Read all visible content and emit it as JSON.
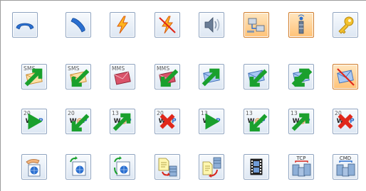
{
  "toolbar": {
    "rows": [
      [
        {
          "name": "hangup-button",
          "icon": "hangup-icon"
        },
        {
          "name": "call-button",
          "icon": "call-icon"
        },
        {
          "name": "lightning-button",
          "icon": "lightning-icon"
        },
        {
          "name": "lightning-off-button",
          "icon": "lightning-off-icon"
        },
        {
          "name": "speaker-button",
          "icon": "speaker-icon"
        },
        {
          "name": "network-button",
          "icon": "network-icon",
          "active": true
        },
        {
          "name": "signal-tower-button",
          "icon": "signal-tower-icon",
          "active": true
        },
        {
          "name": "key-button",
          "icon": "key-icon"
        }
      ],
      [
        {
          "name": "sms-send-button",
          "icon": "sms-envelope-icon",
          "label": "SMS",
          "badge": "send"
        },
        {
          "name": "sms-receive-button",
          "icon": "sms-envelope-icon",
          "label": "SMS",
          "badge": "receive"
        },
        {
          "name": "mms-button",
          "icon": "mms-envelope-icon",
          "label": "MMS"
        },
        {
          "name": "mms-receive-button",
          "icon": "mms-envelope-icon",
          "label": "MMS",
          "badge": "receive"
        },
        {
          "name": "email-send-button",
          "icon": "email-icon",
          "badge": "send"
        },
        {
          "name": "email-receive-button",
          "icon": "email-icon",
          "badge": "receive"
        },
        {
          "name": "email-send-receive-button",
          "icon": "email-icon",
          "badge": "both"
        },
        {
          "name": "email-cancel-button",
          "icon": "email-cancel-icon",
          "active": true
        }
      ],
      [
        {
          "name": "wap-20-play-button",
          "icon": "wap-icon",
          "label": "20",
          "badge": "play"
        },
        {
          "name": "wap-20-receive-button",
          "icon": "wap-icon",
          "label": "20",
          "badge": "receive"
        },
        {
          "name": "wap-13-send-button",
          "icon": "wap-icon",
          "label": "13",
          "badge": "send"
        },
        {
          "name": "wap-20-cancel-button",
          "icon": "wap-icon",
          "label": "20",
          "badge": "cancel"
        },
        {
          "name": "wap-13-play-button",
          "icon": "wap-icon",
          "label": "13",
          "badge": "play"
        },
        {
          "name": "wap-13-receive-button",
          "icon": "wap-icon",
          "label": "13",
          "badge": "receive"
        },
        {
          "name": "wap-13-send-2-button",
          "icon": "wap-icon",
          "label": "13",
          "badge": "send"
        },
        {
          "name": "wap-20-cancel-2-button",
          "icon": "wap-icon",
          "label": "20",
          "badge": "cancel"
        }
      ],
      [
        {
          "name": "web-share-button",
          "icon": "web-share-icon"
        },
        {
          "name": "web-refresh-button",
          "icon": "web-refresh-icon"
        },
        {
          "name": "web-sync-button",
          "icon": "web-sync-icon"
        },
        {
          "name": "document-to-server-button",
          "icon": "document-server-icon"
        },
        {
          "name": "server-to-document-button",
          "icon": "server-document-icon"
        },
        {
          "name": "film-button",
          "icon": "film-icon"
        },
        {
          "name": "tcp-servers-button",
          "icon": "tcp-servers-icon",
          "label": "TCP"
        },
        {
          "name": "cmd-servers-button",
          "icon": "cmd-servers-icon",
          "label": "CMD"
        }
      ]
    ],
    "wap_text": {
      "w": "W",
      "at": "@",
      "p": "P"
    },
    "colors": {
      "active": "#ffc277",
      "border": "#8ea3c0",
      "accent": "#e07a10"
    }
  }
}
